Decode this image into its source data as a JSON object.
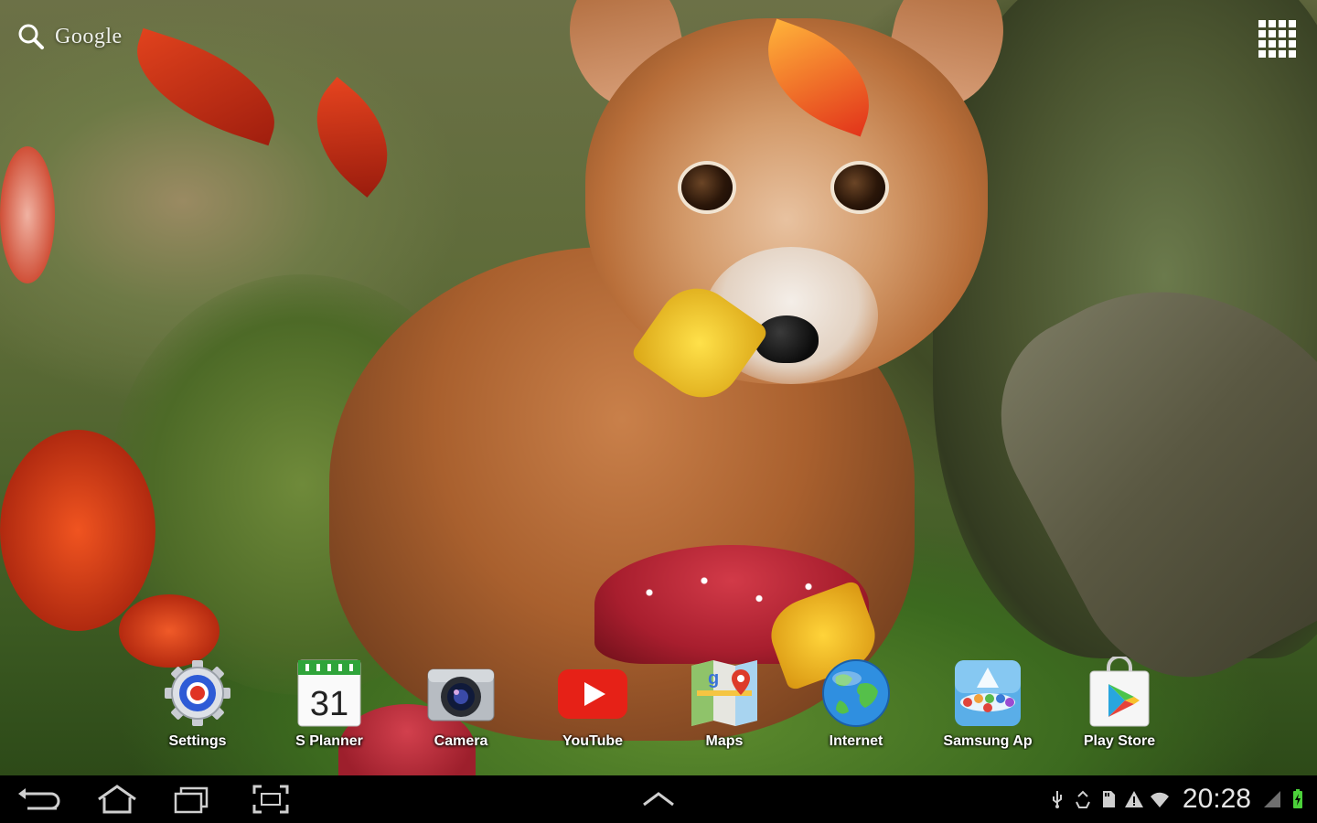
{
  "search": {
    "label": "Google"
  },
  "dock": {
    "items": [
      {
        "label": "Settings",
        "icon": "settings-icon"
      },
      {
        "label": "S Planner",
        "icon": "calendar-icon",
        "date": "31"
      },
      {
        "label": "Camera",
        "icon": "camera-icon"
      },
      {
        "label": "YouTube",
        "icon": "youtube-icon"
      },
      {
        "label": "Maps",
        "icon": "maps-icon"
      },
      {
        "label": "Internet",
        "icon": "globe-icon"
      },
      {
        "label": "Samsung Ap",
        "icon": "samsung-apps-icon"
      },
      {
        "label": "Play Store",
        "icon": "play-store-icon"
      }
    ]
  },
  "status_bar": {
    "time": "20:28",
    "icons": [
      "usb-icon",
      "recycle-icon",
      "sd-card-icon",
      "warning-icon",
      "wifi-icon",
      "signal-icon",
      "battery-charging-icon"
    ]
  },
  "colors": {
    "youtube_red": "#e62117",
    "battery_green": "#4cd13a",
    "calendar_green": "#2fa43a"
  }
}
